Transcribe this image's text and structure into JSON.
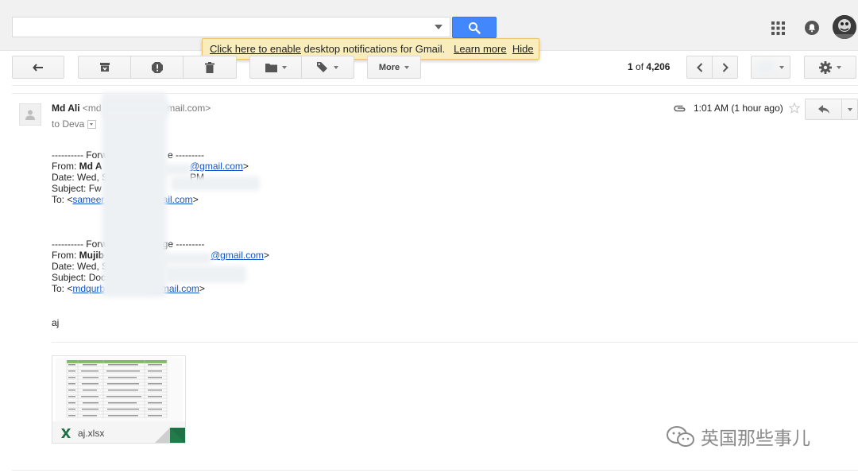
{
  "search": {
    "value": "",
    "placeholder": ""
  },
  "notification_banner": {
    "link_text": "Click here to enable",
    "text": " desktop notifications for Gmail.",
    "learn_more": "Learn more",
    "hide": "Hide"
  },
  "toolbar": {
    "more_label": "More",
    "page_count_range": "1",
    "page_count_of": "of",
    "page_count_total": "4,206"
  },
  "email": {
    "sender_name": "Md Ali",
    "sender_email_start": "<md",
    "sender_email_end": "gmail.com>",
    "to_text": "to Deva",
    "time": "1:01 AM (1 hour ago)",
    "forward1": {
      "header_left": "---------- Forw",
      "header_right": "e ---------",
      "from_label": "From: ",
      "from_name": "Md A",
      "from_email": "@gmail.com",
      "from_email_close": ">",
      "date_left": "Date: Wed, S",
      "date_right": "PM",
      "subject_left": "Subject: Fw",
      "to_label": "To: <",
      "to_email_start": "sameer",
      "to_email_end": "gmail.com",
      "to_close": ">"
    },
    "forward2": {
      "header_left": "---------- Forw",
      "header_right": "ssage ---------",
      "from_label": "From: ",
      "from_name": "Mujib",
      "from_email": "@gmail.com",
      "from_email_close": ">",
      "date_left": "Date: Wed, S",
      "subject_left": "Subject: Doc",
      "to_label": "To: <",
      "to_email_start": "mdqurb",
      "to_email_end": "@gmail.com",
      "to_close": ">"
    },
    "signature": "aj",
    "attachment": {
      "name": "aj.xlsx",
      "icon": "excel-x-icon",
      "color": "#1e7145"
    }
  },
  "watermark": {
    "text": "英国那些事儿"
  },
  "colors": {
    "search_blue": "#4387fd",
    "link": "#1155cc",
    "banner_bg": "#f9edbe"
  }
}
